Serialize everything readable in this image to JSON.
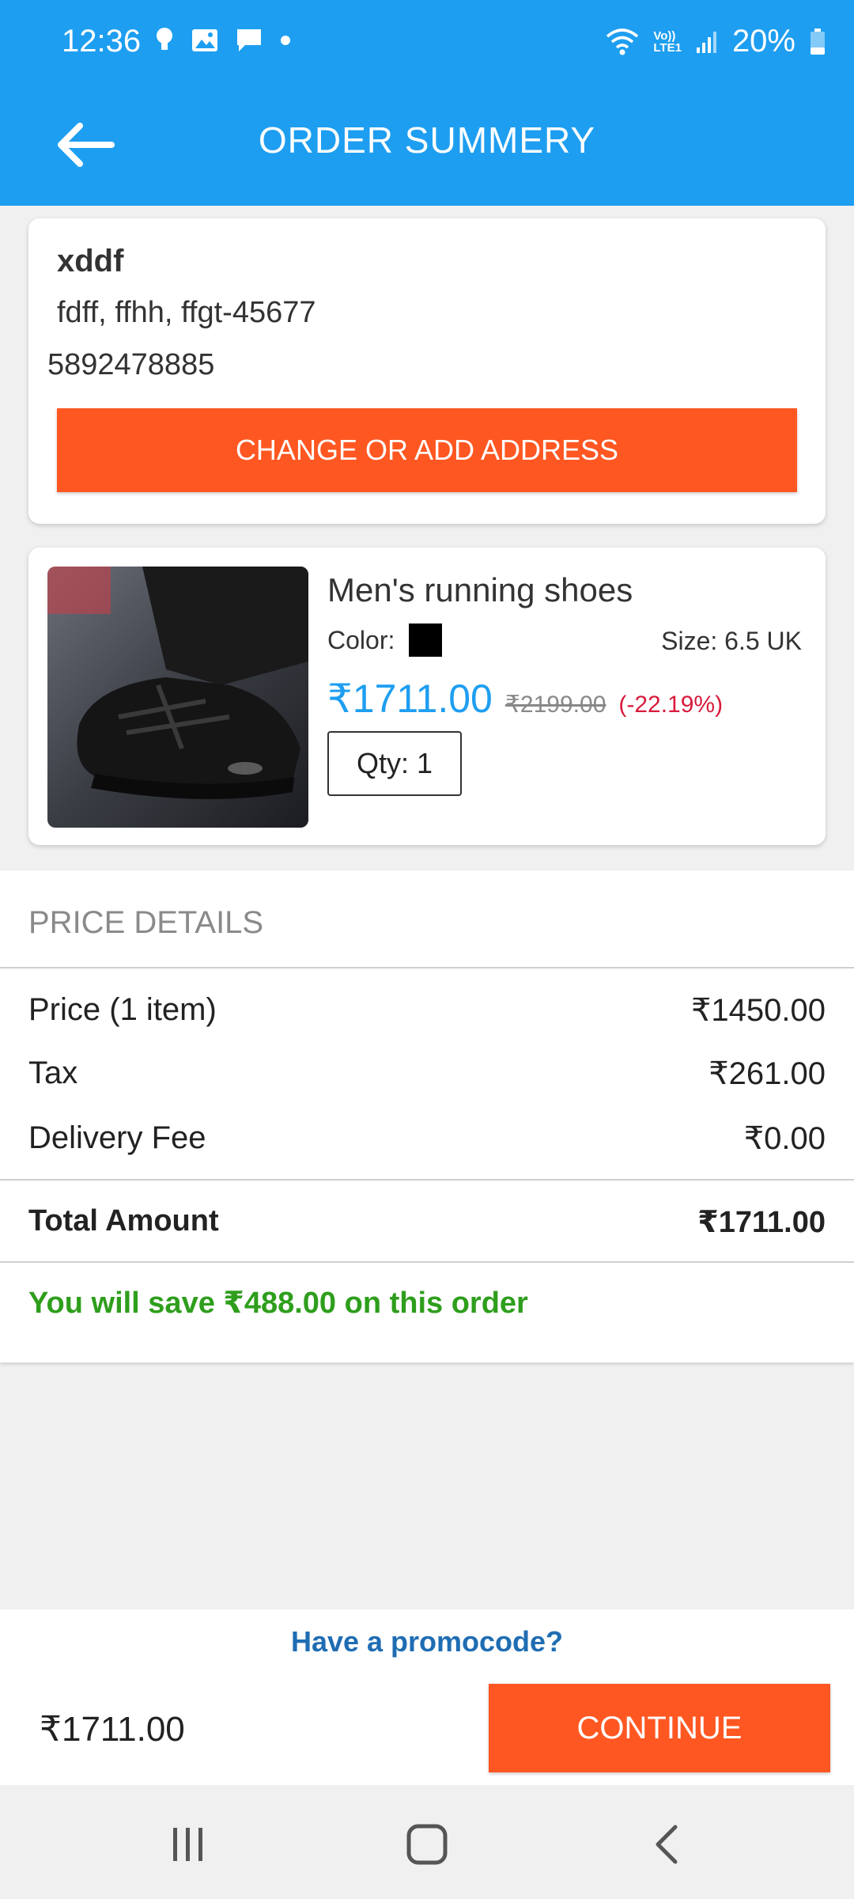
{
  "status_bar": {
    "time": "12:36",
    "battery": "20%",
    "icons": [
      "bulb-icon",
      "image-icon",
      "message-icon",
      "dot-icon",
      "wifi-icon",
      "volte-icon",
      "signal-icon",
      "battery-icon"
    ],
    "volte_label_top": "Vo))",
    "volte_label_bottom": "LTE1"
  },
  "app_bar": {
    "title": "ORDER SUMMERY",
    "back_icon": "arrow-left-icon"
  },
  "address": {
    "name": "xddf",
    "line": "fdff, ffhh, ffgt-45677",
    "phone": "5892478885",
    "button_label": "CHANGE OR ADD ADDRESS"
  },
  "product": {
    "name": "Men's running shoes",
    "color_label": "Color:",
    "color_value": "#000000",
    "size_label": "Size:  6.5 UK",
    "price": "₹1711.00",
    "original_price": "₹2199.00",
    "discount": "(-22.19%)",
    "qty": "Qty: 1",
    "colors": {
      "price": "#1e9ef0",
      "discount": "#d81b3c"
    }
  },
  "price_details": {
    "heading": "PRICE DETAILS",
    "rows": [
      {
        "label": "Price (1 item)",
        "value": "₹1450.00"
      },
      {
        "label": "Tax",
        "value": "₹261.00"
      },
      {
        "label": "Delivery Fee",
        "value": "₹0.00"
      }
    ],
    "total_label": "Total Amount",
    "total_value": "₹1711.00",
    "savings": "You will save ₹488.00 on this order"
  },
  "bottom_bar": {
    "promo_link": "Have a promocode?",
    "total": "₹1711.00",
    "continue_label": "CONTINUE"
  },
  "nav_bar": {
    "icons": [
      "recent-apps-icon",
      "home-icon",
      "back-icon"
    ]
  },
  "colors": {
    "primary": "#1e9ef0",
    "accent": "#ff5722",
    "savings": "#2e9e1c",
    "link": "#1f6db3"
  }
}
